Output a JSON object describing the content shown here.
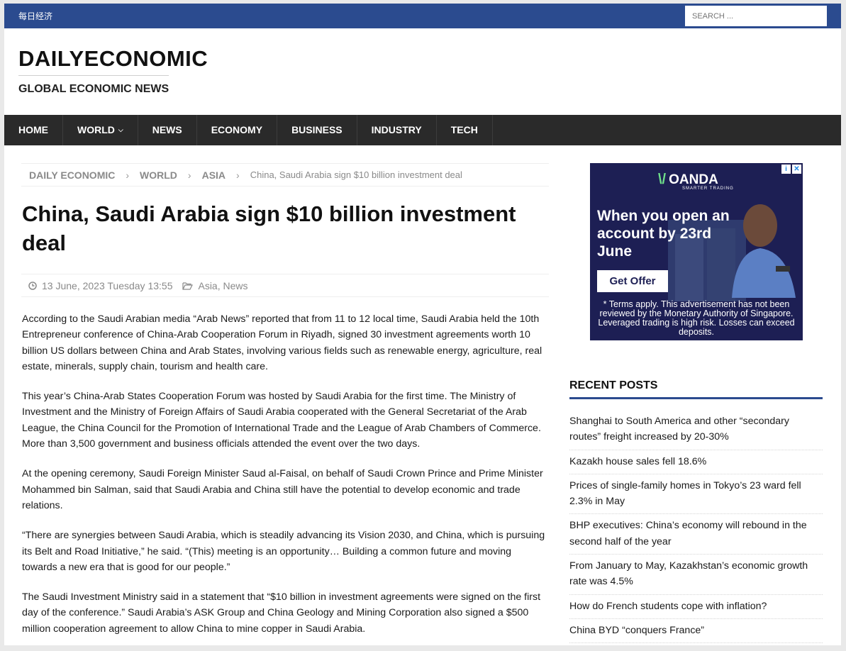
{
  "topbar": {
    "site_name_cn": "每日经济",
    "search_placeholder": "SEARCH ..."
  },
  "header": {
    "logo": "DAILYECONOMIC",
    "tagline": "GLOBAL ECONOMIC NEWS"
  },
  "nav": {
    "items": [
      "HOME",
      "WORLD",
      "NEWS",
      "ECONOMY",
      "BUSINESS",
      "INDUSTRY",
      "TECH"
    ]
  },
  "breadcrumb": {
    "items": [
      "DAILY ECONOMIC",
      "WORLD",
      "ASIA"
    ],
    "current": "China, Saudi Arabia sign $10 billion investment deal"
  },
  "article": {
    "title": "China, Saudi Arabia sign $10 billion investment deal",
    "date": "13 June, 2023 Tuesday 13:55",
    "categories": [
      "Asia",
      "News"
    ],
    "paragraphs": [
      "According to the Saudi Arabian media “Arab News” reported that from 11 to 12 local time, Saudi Arabia held the 10th Entrepreneur conference of China-Arab Cooperation Forum in Riyadh, signed 30 investment agreements worth 10 billion US dollars between China and Arab States, involving various fields such as renewable energy, agriculture, real estate, minerals, supply chain, tourism and health care.",
      "This year’s China-Arab States Cooperation Forum was hosted by Saudi Arabia for the first time. The Ministry of Investment and the Ministry of Foreign Affairs of Saudi Arabia cooperated with the General Secretariat of the Arab League, the China Council for the Promotion of International Trade and the League of Arab Chambers of Commerce. More than 3,500 government and business officials attended the event over the two days.",
      "At the opening ceremony, Saudi Foreign Minister Saud al-Faisal, on behalf of Saudi Crown Prince and Prime Minister Mohammed bin Salman, said that Saudi Arabia and China still have the potential to develop economic and trade relations.",
      "“There are synergies between Saudi Arabia, which is steadily advancing its Vision 2030, and China, which is pursuing its Belt and Road Initiative,” he said. “(This) meeting is an opportunity… Building a common future and moving towards a new era that is good for our people.”",
      "The Saudi Investment Ministry said in a statement that “$10 billion in investment agreements were signed on the first day of the conference.” Saudi Arabia’s ASK Group and China Geology and Mining Corporation also signed a $500 million cooperation agreement to allow China to mine copper in Saudi Arabia."
    ]
  },
  "ad": {
    "brand": "OANDA",
    "brand_sub": "SMARTER TRADING",
    "headline": "When you open an account by 23rd June",
    "cta": "Get Offer",
    "disclaimer": "* Terms apply. This advertisement has not been reviewed by the Monetary Authority of Singapore. Leveraged trading is high risk. Losses can exceed deposits."
  },
  "recent_posts": {
    "title": "RECENT POSTS",
    "items": [
      "Shanghai to South America and other “secondary routes” freight increased by 20-30%",
      "Kazakh house sales fell 18.6%",
      "Prices of single-family homes in Tokyo’s 23 ward fell 2.3% in May",
      "BHP executives: China’s economy will rebound in the second half of the year",
      "From January to May, Kazakhstan’s economic growth rate was 4.5%",
      "How do French students cope with inflation?",
      "China BYD “conquers France”"
    ]
  },
  "colors": {
    "topbar": "#2b4b8f",
    "nav": "#2a2a2a",
    "accent": "#2b4b8f",
    "ad_background": "#1d1f54"
  }
}
